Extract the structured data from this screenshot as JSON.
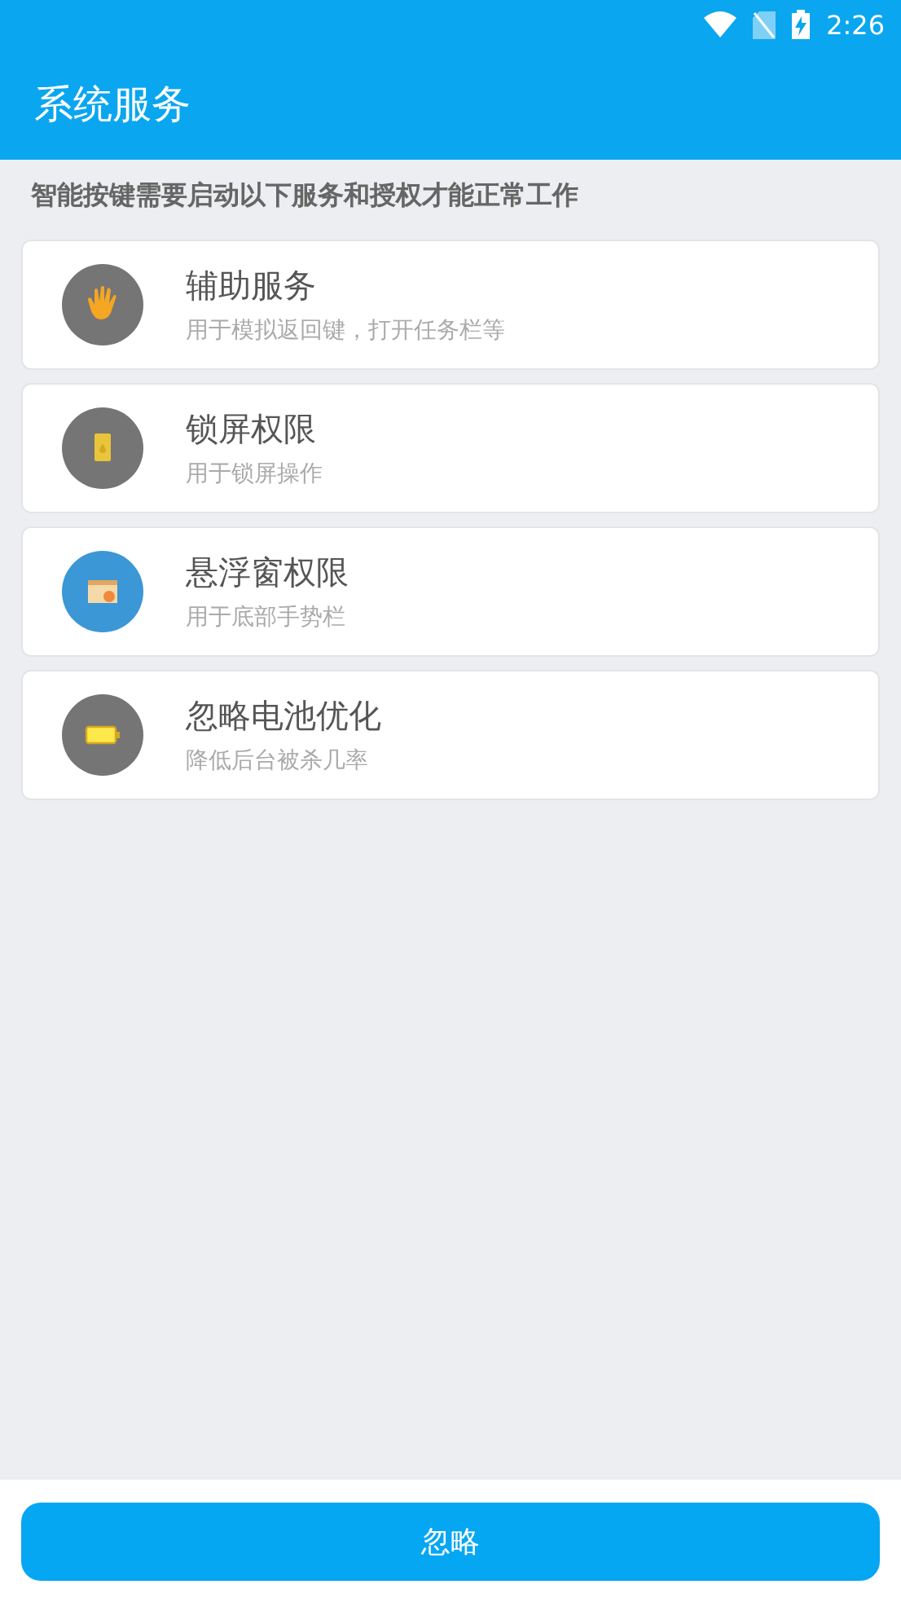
{
  "status_bar": {
    "time": "2:26"
  },
  "app_bar": {
    "title": "系统服务"
  },
  "notice": "智能按键需要启动以下服务和授权才能正常工作",
  "services": [
    {
      "kind": "hand",
      "title": "辅助服务",
      "subtitle": "用于模拟返回键，打开任务栏等"
    },
    {
      "kind": "phone",
      "title": "锁屏权限",
      "subtitle": "用于锁屏操作"
    },
    {
      "kind": "window",
      "title": "悬浮窗权限",
      "subtitle": "用于底部手势栏"
    },
    {
      "kind": "battery",
      "title": "忽略电池优化",
      "subtitle": "降低后台被杀几率"
    }
  ],
  "buttons": [
    "忽略"
  ]
}
